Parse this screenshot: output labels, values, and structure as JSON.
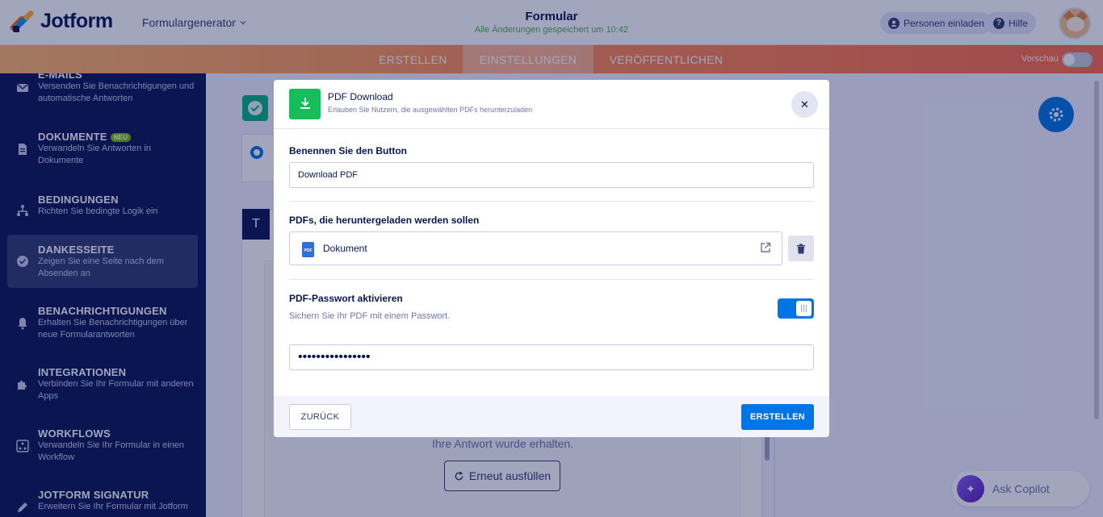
{
  "header": {
    "brand": "Jotform",
    "form_generator": "Formulargenerator",
    "form_title": "Formular",
    "save_status": "Alle Änderungen gespeichert um 10:42",
    "invite_label": "Personen einladen",
    "help_label": "Hilfe"
  },
  "nav": {
    "tabs": [
      {
        "label": "ERSTELLEN"
      },
      {
        "label": "EINSTELLUNGEN"
      },
      {
        "label": "VERÖFFENTLICHEN"
      }
    ],
    "active_tab": "EINSTELLUNGEN",
    "preview_label": "Vorschau"
  },
  "sidebar": {
    "items": [
      {
        "title": "E-MAILS",
        "desc": "Versenden Sie Benachrichtigungen und automatische Antworten",
        "icon": "mail-icon"
      },
      {
        "title": "DOKUMENTE",
        "badge": "NEU",
        "desc": "Verwandeln Sie Antworten in Dokumente",
        "icon": "document-icon"
      },
      {
        "title": "BEDINGUNGEN",
        "desc": "Richten Sie bedingte Logik ein",
        "icon": "conditions-icon"
      },
      {
        "title": "DANKESSEITE",
        "desc": "Zeigen Sie eine Seite nach dem Absenden an",
        "icon": "check-circle-icon"
      },
      {
        "title": "BENACHRICHTIGUNGEN",
        "desc": "Erhalten Sie Benachrichtigungen über neue Formularantworten",
        "icon": "bell-icon"
      },
      {
        "title": "INTEGRATIONEN",
        "desc": "Verbinden Sie Ihr Formular mit anderen Apps",
        "icon": "puzzle-icon"
      },
      {
        "title": "WORKFLOWS",
        "desc": "Verwandeln Sie Ihr Formular in einen Workflow",
        "icon": "workflow-icon"
      },
      {
        "title": "JOTFORM SIGNATUR",
        "desc": "Erweitern Sie Ihr Formular mit Jotform",
        "icon": "signature-icon"
      }
    ],
    "active_item": "DANKESSEITE"
  },
  "main": {
    "answer_text": "Ihre Antwort wurde erhalten.",
    "refill_label": "Erneut ausfüllen",
    "copilot_label": "Ask Copilot"
  },
  "modal": {
    "title": "PDF Download",
    "subtitle": "Erlauben Sie Nutzern, die ausgewählten PDFs herunterzuladen",
    "button_name_label": "Benennen Sie den Button",
    "button_name_value": "Download PDF",
    "pdfs_label": "PDFs, die heruntergeladen werden sollen",
    "pdf_icon_text": "PDF",
    "document_name": "Dokument",
    "password_label": "PDF-Passwort aktivieren",
    "password_hint": "Sichern Sie Ihr PDF mit einem Passwort.",
    "password_enabled": true,
    "password_masked": "••••••••••••••••",
    "back_label": "ZURÜCK",
    "create_label": "ERSTELLEN"
  },
  "colors": {
    "brand_navy": "#0a1551",
    "accent_blue": "#0075e3",
    "success_green": "#18bd5b",
    "nav_orange": "#ff8a4f"
  }
}
